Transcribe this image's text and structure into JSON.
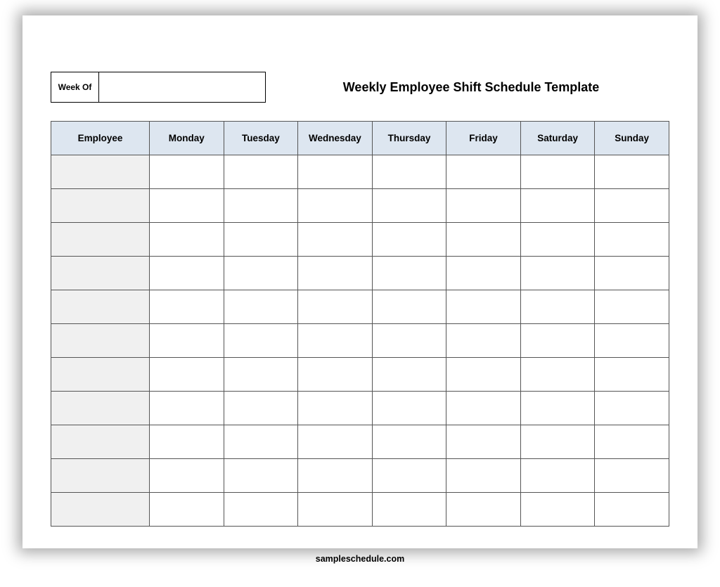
{
  "document": {
    "title": "Weekly Employee Shift Schedule Template",
    "week_of_label": "Week Of",
    "week_of_value": "",
    "footer": "sampleschedule.com"
  },
  "schedule": {
    "columns": [
      "Employee",
      "Monday",
      "Tuesday",
      "Wednesday",
      "Thursday",
      "Friday",
      "Saturday",
      "Sunday"
    ],
    "rows": [
      {
        "employee": "",
        "cells": [
          "",
          "",
          "",
          "",
          "",
          "",
          ""
        ]
      },
      {
        "employee": "",
        "cells": [
          "",
          "",
          "",
          "",
          "",
          "",
          ""
        ]
      },
      {
        "employee": "",
        "cells": [
          "",
          "",
          "",
          "",
          "",
          "",
          ""
        ]
      },
      {
        "employee": "",
        "cells": [
          "",
          "",
          "",
          "",
          "",
          "",
          ""
        ]
      },
      {
        "employee": "",
        "cells": [
          "",
          "",
          "",
          "",
          "",
          "",
          ""
        ]
      },
      {
        "employee": "",
        "cells": [
          "",
          "",
          "",
          "",
          "",
          "",
          ""
        ]
      },
      {
        "employee": "",
        "cells": [
          "",
          "",
          "",
          "",
          "",
          "",
          ""
        ]
      },
      {
        "employee": "",
        "cells": [
          "",
          "",
          "",
          "",
          "",
          "",
          ""
        ]
      },
      {
        "employee": "",
        "cells": [
          "",
          "",
          "",
          "",
          "",
          "",
          ""
        ]
      },
      {
        "employee": "",
        "cells": [
          "",
          "",
          "",
          "",
          "",
          "",
          ""
        ]
      },
      {
        "employee": "",
        "cells": [
          "",
          "",
          "",
          "",
          "",
          "",
          ""
        ]
      }
    ]
  }
}
